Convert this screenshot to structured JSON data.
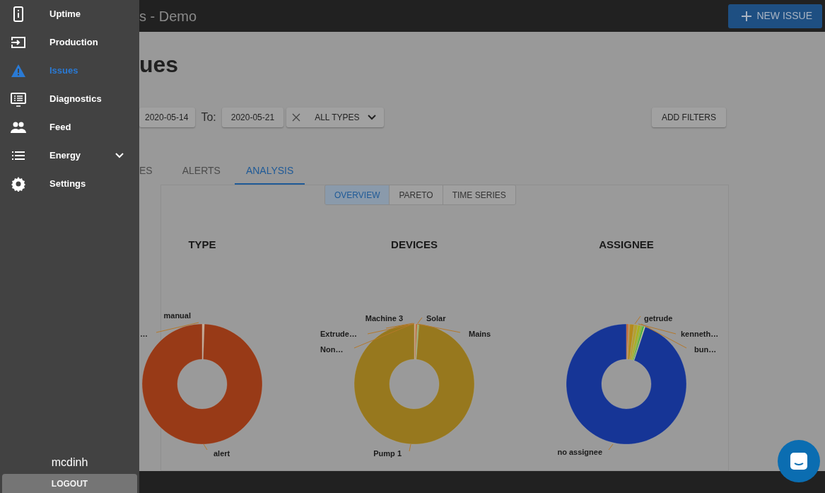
{
  "sidebar": {
    "items": [
      {
        "label": "Uptime",
        "selected": false
      },
      {
        "label": "Production",
        "selected": false
      },
      {
        "label": "Issues",
        "selected": true
      },
      {
        "label": "Diagnostics",
        "selected": false
      },
      {
        "label": "Feed",
        "selected": false
      },
      {
        "label": "Energy",
        "selected": false,
        "expanded": false
      },
      {
        "label": "Settings",
        "selected": false
      }
    ],
    "user": "mcdinh",
    "logout": "LOGOUT"
  },
  "app_bar": {
    "title": "s - Demo",
    "new_issue": "NEW ISSUE"
  },
  "page_title": "ues",
  "filters": {
    "from": "2020-05-14",
    "to_label": "To:",
    "to": "2020-05-21",
    "type": "ALL TYPES",
    "add": "ADD FILTERS"
  },
  "tabs": [
    {
      "label": "ES",
      "selected": false
    },
    {
      "label": "ALERTS",
      "selected": false
    },
    {
      "label": "ANALYSIS",
      "selected": true
    }
  ],
  "views": [
    {
      "label": "OVERVIEW",
      "selected": true
    },
    {
      "label": "PARETO",
      "selected": false
    },
    {
      "label": "TIME SERIES",
      "selected": false
    }
  ],
  "charts": [
    {
      "title": "TYPE",
      "labels": [
        "manual",
        "…",
        "alert"
      ]
    },
    {
      "title": "DEVICES",
      "labels": [
        "Machine 3",
        "Solar",
        "Extrude…",
        "Mains",
        "Non…",
        "Pump 1"
      ]
    },
    {
      "title": "ASSIGNEE",
      "labels": [
        "getrude",
        "kenneth…",
        "bun…",
        "no assignee"
      ]
    }
  ]
}
